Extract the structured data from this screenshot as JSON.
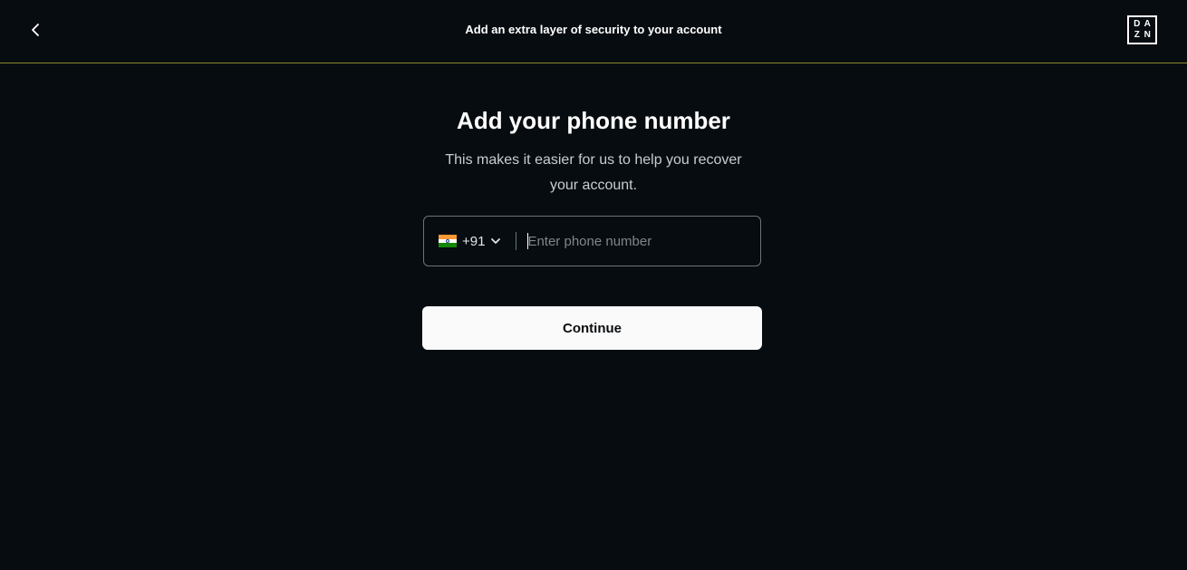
{
  "header": {
    "title": "Add an extra layer of security to your account",
    "logo": {
      "letters": [
        "D",
        "A",
        "Z",
        "N"
      ]
    }
  },
  "main": {
    "title": "Add your phone number",
    "subtitle": "This makes it easier for us to help you recover your account."
  },
  "phone_field": {
    "country_flag": "india-flag-icon",
    "dial_code": "+91",
    "placeholder": "Enter phone number",
    "value": ""
  },
  "continue_button": {
    "label": "Continue"
  },
  "colors": {
    "background": "#070c10",
    "header_border": "#8a8a2a",
    "button_bg": "#fafafa",
    "flag_saffron": "#ff9933",
    "flag_white": "#ffffff",
    "flag_green": "#138808"
  }
}
